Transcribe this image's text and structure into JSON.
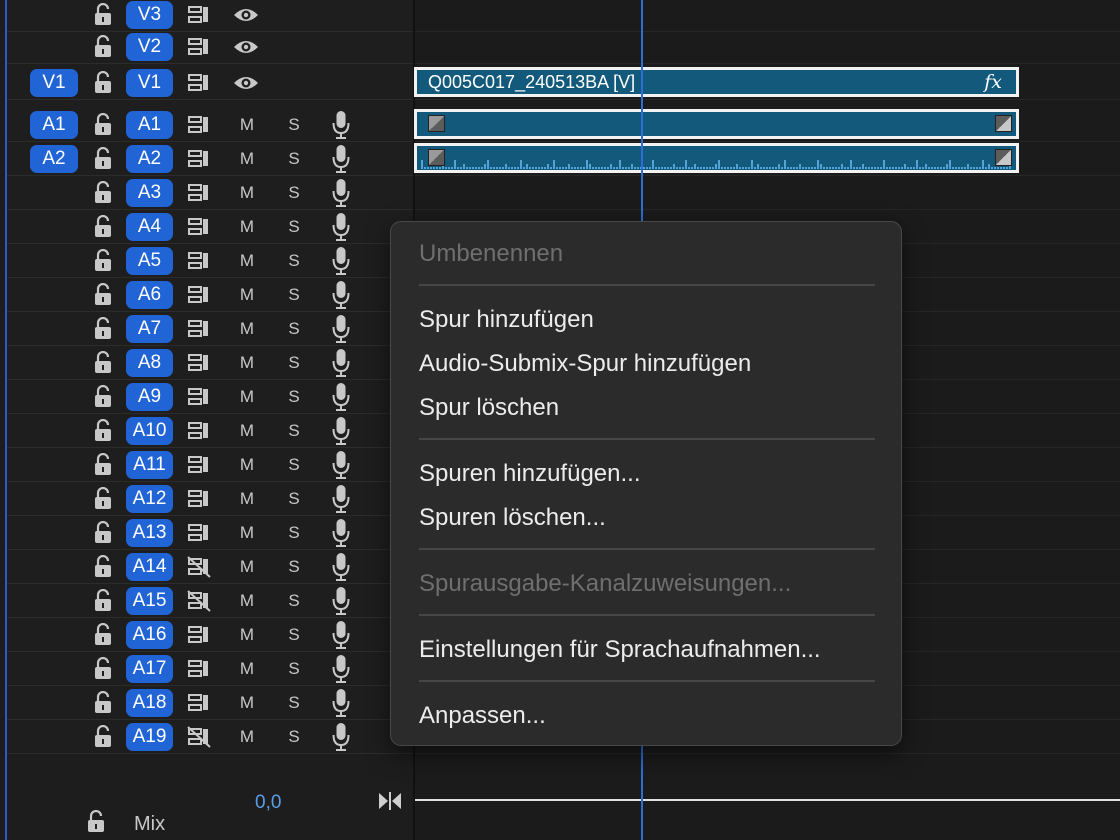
{
  "video_tracks": [
    {
      "source": "",
      "target": "V3"
    },
    {
      "source": "",
      "target": "V2"
    },
    {
      "source": "V1",
      "target": "V1"
    }
  ],
  "audio_tracks": [
    {
      "source": "A1",
      "target": "A1",
      "mute": "M",
      "solo": "S",
      "sync_lock": true
    },
    {
      "source": "A2",
      "target": "A2",
      "mute": "M",
      "solo": "S",
      "sync_lock": true
    },
    {
      "source": "",
      "target": "A3",
      "mute": "M",
      "solo": "S",
      "sync_lock": true
    },
    {
      "source": "",
      "target": "A4",
      "mute": "M",
      "solo": "S",
      "sync_lock": true
    },
    {
      "source": "",
      "target": "A5",
      "mute": "M",
      "solo": "S",
      "sync_lock": true
    },
    {
      "source": "",
      "target": "A6",
      "mute": "M",
      "solo": "S",
      "sync_lock": true
    },
    {
      "source": "",
      "target": "A7",
      "mute": "M",
      "solo": "S",
      "sync_lock": true
    },
    {
      "source": "",
      "target": "A8",
      "mute": "M",
      "solo": "S",
      "sync_lock": true
    },
    {
      "source": "",
      "target": "A9",
      "mute": "M",
      "solo": "S",
      "sync_lock": true
    },
    {
      "source": "",
      "target": "A10",
      "mute": "M",
      "solo": "S",
      "sync_lock": true
    },
    {
      "source": "",
      "target": "A11",
      "mute": "M",
      "solo": "S",
      "sync_lock": true
    },
    {
      "source": "",
      "target": "A12",
      "mute": "M",
      "solo": "S",
      "sync_lock": true
    },
    {
      "source": "",
      "target": "A13",
      "mute": "M",
      "solo": "S",
      "sync_lock": true
    },
    {
      "source": "",
      "target": "A14",
      "mute": "M",
      "solo": "S",
      "sync_lock": false
    },
    {
      "source": "",
      "target": "A15",
      "mute": "M",
      "solo": "S",
      "sync_lock": false
    },
    {
      "source": "",
      "target": "A16",
      "mute": "M",
      "solo": "S",
      "sync_lock": true
    },
    {
      "source": "",
      "target": "A17",
      "mute": "M",
      "solo": "S",
      "sync_lock": true
    },
    {
      "source": "",
      "target": "A18",
      "mute": "M",
      "solo": "S",
      "sync_lock": true
    },
    {
      "source": "",
      "target": "A19",
      "mute": "M",
      "solo": "S",
      "sync_lock": false
    }
  ],
  "clips": {
    "video_clip_name": "Q005C017_240513BA [V]",
    "fx_badge": "fx"
  },
  "mix": {
    "label": "Mix",
    "value": "0,0"
  },
  "context_menu": {
    "items": [
      {
        "label": "Umbenennen",
        "enabled": false
      },
      {
        "label": "Spur hinzufügen",
        "enabled": true
      },
      {
        "label": "Audio-Submix-Spur hinzufügen",
        "enabled": true
      },
      {
        "label": "Spur löschen",
        "enabled": true
      },
      {
        "label": "Spuren hinzufügen...",
        "enabled": true
      },
      {
        "label": "Spuren löschen...",
        "enabled": true
      },
      {
        "label": "Spurausgabe-Kanalzuweisungen...",
        "enabled": false
      },
      {
        "label": "Einstellungen für Sprachaufnahmen...",
        "enabled": true
      },
      {
        "label": "Anpassen...",
        "enabled": true
      }
    ]
  },
  "colors": {
    "accent": "#2164d6",
    "clip": "#12597b",
    "playhead": "#2d6ed8"
  }
}
